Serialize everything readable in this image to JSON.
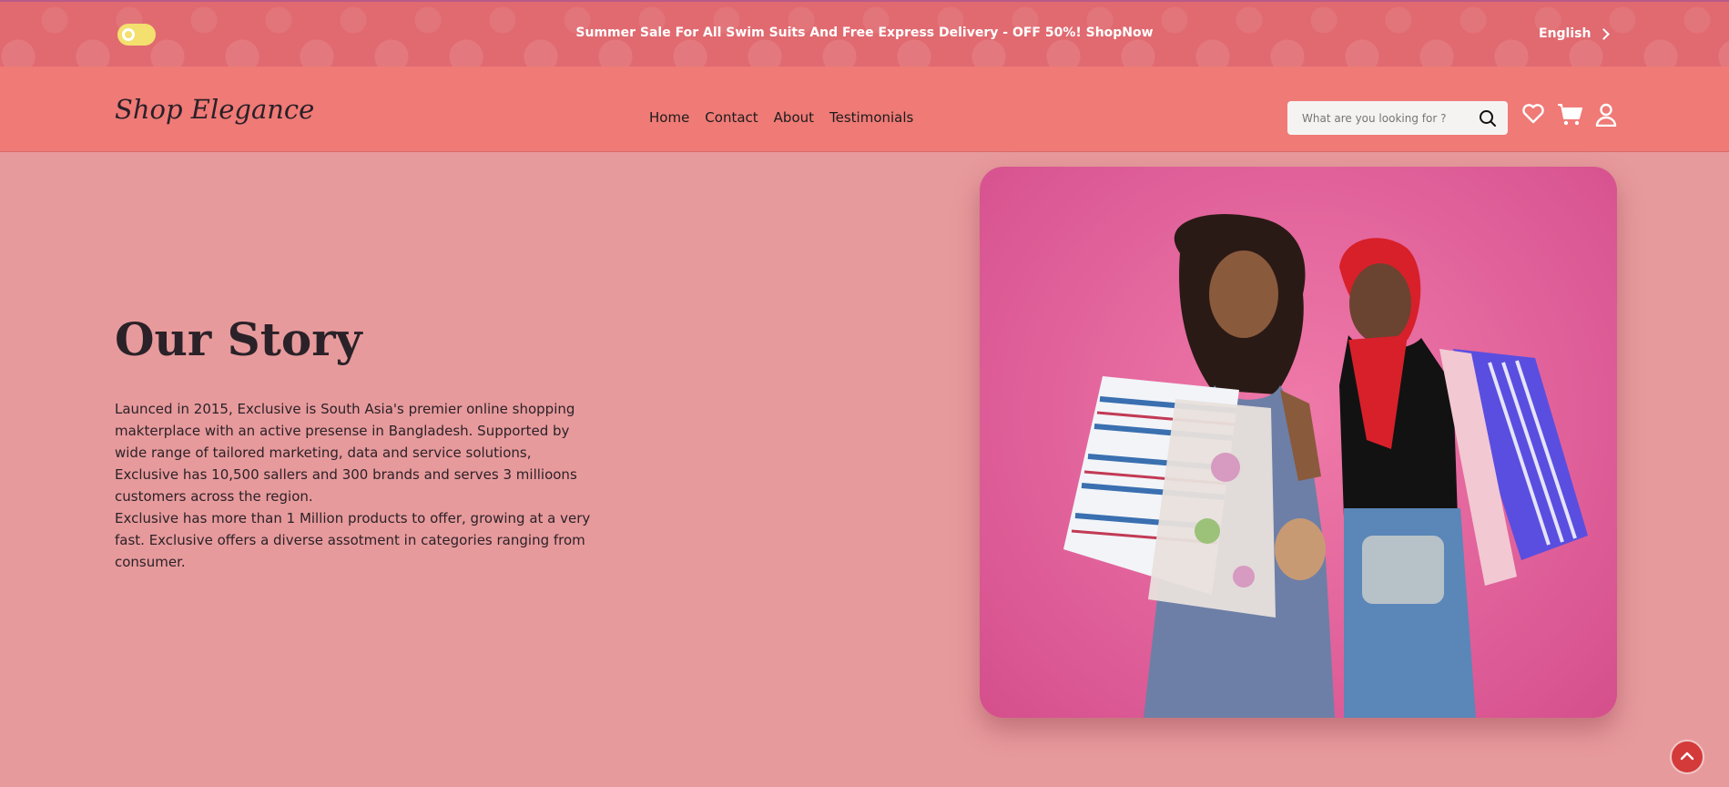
{
  "topbar": {
    "announcement": "Summer Sale For All Swim Suits And Free Express Delivery - OFF 50%! ShopNow",
    "language": "English"
  },
  "header": {
    "logo": "Shop Elegance",
    "nav": [
      "Home",
      "Contact",
      "About",
      "Testimonials"
    ],
    "search_placeholder": "What are you looking for ?"
  },
  "main": {
    "title": "Our Story",
    "paragraph_1": "Launced in 2015, Exclusive is South Asia's premier online shopping makterplace with an active presense in Bangladesh. Supported by wide range of tailored marketing, data and service solutions, Exclusive has 10,500 sallers and 300 brands and serves 3 millioons customers across the region.",
    "paragraph_2": "Exclusive has more than 1 Million products to offer, growing at a very fast. Exclusive offers a diverse assotment in categories ranging from consumer."
  },
  "icons": {
    "theme_toggle": "toggle-icon",
    "language_chevron": "chevron-right-icon",
    "search": "search-icon",
    "wishlist": "heart-icon",
    "cart": "cart-icon",
    "account": "user-icon",
    "scroll_top": "chevron-up-icon"
  },
  "colors": {
    "topbar_bg": "#e06a70",
    "header_bg": "#ef7a76",
    "page_bg": "#e79a9c",
    "toggle": "#f3e06e",
    "scroll_top": "#d43a3a"
  }
}
